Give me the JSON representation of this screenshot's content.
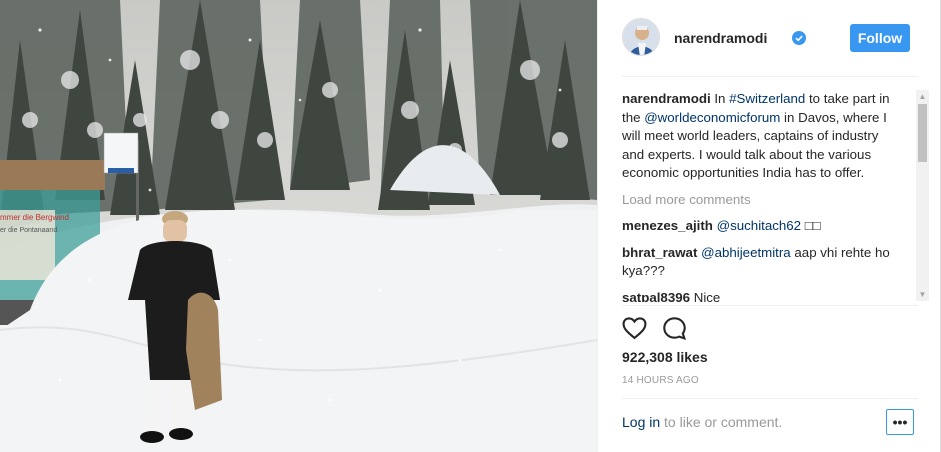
{
  "post": {
    "username": "narendramodi",
    "follow_label": "Follow",
    "caption": {
      "user": "narendramodi",
      "t1": " In ",
      "hashtag": "#Switzerland",
      "t2": " to take part in the ",
      "mention": "@worldeconomicforum",
      "t3": " in Davos, where I will meet world leaders, captains of industry and experts. I would talk about the various economic opportunities India has to offer."
    },
    "load_more": "Load more comments",
    "comments": [
      {
        "user": "menezes_ajith",
        "mention": "@suchitach62",
        "text": " □□"
      },
      {
        "user": "bhrat_rawat",
        "mention": "@abhijeetmitra",
        "text": " aap vhi rehte ho kya???"
      },
      {
        "user": "satpal8396",
        "mention": "",
        "text": " Nice"
      }
    ],
    "likes": "922,308 likes",
    "timestamp": "14 HOURS AGO",
    "login_link": "Log in",
    "login_suffix": " to like or comment.",
    "more_label": "•••"
  },
  "photo": {
    "sign_text_1": "mmer die Bergwind",
    "sign_text_2": "er die Pontanaand"
  },
  "colors": {
    "accent": "#3897f0",
    "link": "#003569",
    "muted": "#999999"
  },
  "icons": [
    "verified-badge-icon",
    "heart-icon",
    "comment-icon",
    "scroll-up-icon",
    "scroll-down-icon"
  ]
}
